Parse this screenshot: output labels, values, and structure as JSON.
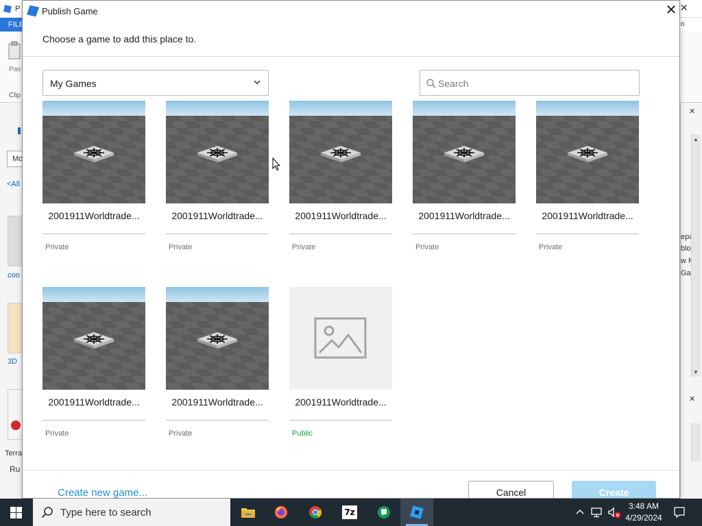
{
  "background": {
    "title_fragment": "P",
    "ribbon_tab": "FILE",
    "ribbon_labels": {
      "paste": "Pas",
      "clipboard": "Clip",
      "right_tab": "n"
    },
    "left_panel": {
      "dropdown_fragment": "Mo",
      "all_link": "<All",
      "item1": "coo",
      "item2": "3D",
      "item3": "Terra",
      "run": "Ru"
    },
    "right_panel": {
      "line1": "epa",
      "line2": "blo",
      "line3": "w M",
      "line4": "Gar"
    }
  },
  "dialog": {
    "title": "Publish Game",
    "close_glyph": "✕",
    "instruction": "Choose a game to add this place to.",
    "category": {
      "selected": "My Games"
    },
    "search": {
      "placeholder": "Search",
      "value": ""
    },
    "games": [
      {
        "name": "2001911Worldtrade...",
        "status": "Private",
        "thumb": "baseplate"
      },
      {
        "name": "2001911Worldtrade...",
        "status": "Private",
        "thumb": "baseplate"
      },
      {
        "name": "2001911Worldtrade...",
        "status": "Private",
        "thumb": "baseplate"
      },
      {
        "name": "2001911Worldtrade...",
        "status": "Private",
        "thumb": "baseplate"
      },
      {
        "name": "2001911Worldtrade...",
        "status": "Private",
        "thumb": "baseplate"
      },
      {
        "name": "2001911Worldtrade...",
        "status": "Private",
        "thumb": "baseplate"
      },
      {
        "name": "2001911Worldtrade...",
        "status": "Private",
        "thumb": "baseplate"
      },
      {
        "name": "2001911Worldtrade...",
        "status": "Public",
        "thumb": "image-placeholder-icon"
      }
    ],
    "create_new_link": "Create new game...",
    "cancel_label": "Cancel",
    "create_label": "Create"
  },
  "taskbar": {
    "search_placeholder": "Type here to search",
    "apps": [
      "file-explorer-icon",
      "firefox-icon",
      "chrome-icon",
      "7zip-icon",
      "chat-icon",
      "roblox-studio-icon"
    ],
    "sevenzip_label": "7z",
    "time": "3:48 AM",
    "date": "4/29/2024"
  },
  "colors": {
    "accent": "#2b77d9",
    "link": "#1a8fd8",
    "public_status": "#1e9e4a",
    "create_disabled": "#a7d9f5",
    "taskbar": "#1f2a33"
  }
}
